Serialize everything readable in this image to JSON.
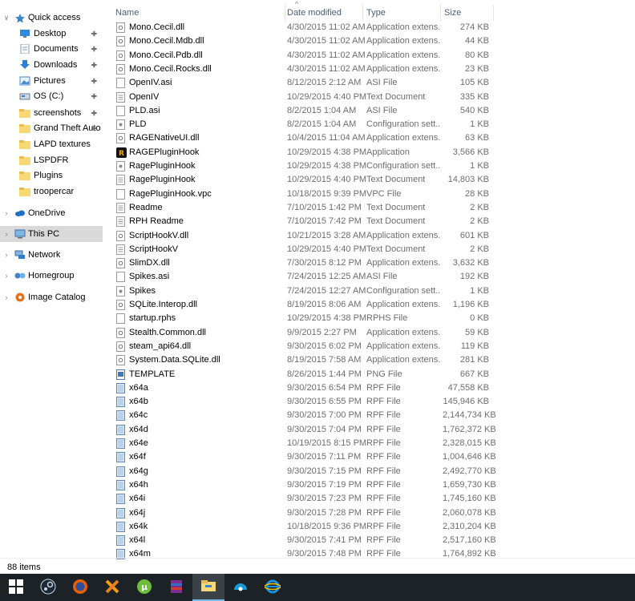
{
  "window": {
    "status_items": "88 items"
  },
  "colors": {
    "selected_bg": "#d9d9d9",
    "header_text": "#4c607a",
    "taskbar_bg": "#1c2226",
    "folder": "#f8d775"
  },
  "nav": {
    "items": [
      {
        "label": "Quick access",
        "icon": "star-icon",
        "chevron": "v",
        "pinned": false,
        "type": "root",
        "selected": false
      },
      {
        "label": "Desktop",
        "icon": "desktop-icon",
        "chevron": "",
        "pinned": true,
        "type": "child",
        "selected": false
      },
      {
        "label": "Documents",
        "icon": "documents-icon",
        "chevron": "",
        "pinned": true,
        "type": "child",
        "selected": false
      },
      {
        "label": "Downloads",
        "icon": "downloads-icon",
        "chevron": "",
        "pinned": true,
        "type": "child",
        "selected": false
      },
      {
        "label": "Pictures",
        "icon": "pictures-icon",
        "chevron": "",
        "pinned": true,
        "type": "child",
        "selected": false
      },
      {
        "label": "OS (C:)",
        "icon": "drive-icon",
        "chevron": "",
        "pinned": true,
        "type": "child",
        "selected": false
      },
      {
        "label": "screenshots",
        "icon": "folder-icon",
        "chevron": "",
        "pinned": true,
        "type": "child",
        "selected": false
      },
      {
        "label": "Grand Theft Auto",
        "icon": "folder-icon",
        "chevron": "",
        "pinned": true,
        "type": "child",
        "selected": false
      },
      {
        "label": "LAPD textures",
        "icon": "folder-icon",
        "chevron": "",
        "pinned": false,
        "type": "child",
        "selected": false
      },
      {
        "label": "LSPDFR",
        "icon": "folder-icon",
        "chevron": "",
        "pinned": false,
        "type": "child",
        "selected": false
      },
      {
        "label": "Plugins",
        "icon": "folder-icon",
        "chevron": "",
        "pinned": false,
        "type": "child",
        "selected": false
      },
      {
        "label": "troopercar",
        "icon": "folder-icon",
        "chevron": "",
        "pinned": false,
        "type": "child",
        "selected": false
      },
      {
        "label": "OneDrive",
        "icon": "cloud-icon",
        "chevron": ">",
        "pinned": false,
        "type": "root",
        "selected": false
      },
      {
        "label": "This PC",
        "icon": "computer-icon",
        "chevron": ">",
        "pinned": false,
        "type": "root",
        "selected": true
      },
      {
        "label": "Network",
        "icon": "network-icon",
        "chevron": ">",
        "pinned": false,
        "type": "root",
        "selected": false
      },
      {
        "label": "Homegroup",
        "icon": "homegroup-icon",
        "chevron": ">",
        "pinned": false,
        "type": "root",
        "selected": false
      },
      {
        "label": "Image Catalog",
        "icon": "catalog-icon",
        "chevron": ">",
        "pinned": false,
        "type": "root",
        "selected": false
      }
    ]
  },
  "columns": {
    "name": "Name",
    "date": "Date modified",
    "type": "Type",
    "size": "Size"
  },
  "files": [
    {
      "name": "Mono.Cecil.dll",
      "date": "4/30/2015 11:02 AM",
      "type": "Application extens...",
      "size": "274 KB",
      "icon": "dll-icon"
    },
    {
      "name": "Mono.Cecil.Mdb.dll",
      "date": "4/30/2015 11:02 AM",
      "type": "Application extens...",
      "size": "44 KB",
      "icon": "dll-icon"
    },
    {
      "name": "Mono.Cecil.Pdb.dll",
      "date": "4/30/2015 11:02 AM",
      "type": "Application extens...",
      "size": "80 KB",
      "icon": "dll-icon"
    },
    {
      "name": "Mono.Cecil.Rocks.dll",
      "date": "4/30/2015 11:02 AM",
      "type": "Application extens...",
      "size": "23 KB",
      "icon": "dll-icon"
    },
    {
      "name": "OpenIV.asi",
      "date": "8/12/2015 2:12 AM",
      "type": "ASI File",
      "size": "105 KB",
      "icon": "file-icon"
    },
    {
      "name": "OpenIV",
      "date": "10/29/2015 4:40 PM",
      "type": "Text Document",
      "size": "335 KB",
      "icon": "text-icon"
    },
    {
      "name": "PLD.asi",
      "date": "8/2/2015 1:04 AM",
      "type": "ASI File",
      "size": "540 KB",
      "icon": "file-icon"
    },
    {
      "name": "PLD",
      "date": "8/2/2015 1:04 AM",
      "type": "Configuration sett...",
      "size": "1 KB",
      "icon": "config-icon"
    },
    {
      "name": "RAGENativeUI.dll",
      "date": "10/4/2015 11:04 AM",
      "type": "Application extens...",
      "size": "63 KB",
      "icon": "dll-icon"
    },
    {
      "name": "RAGEPluginHook",
      "date": "10/29/2015 4:38 PM",
      "type": "Application",
      "size": "3,566 KB",
      "icon": "rage-app-icon"
    },
    {
      "name": "RagePluginHook",
      "date": "10/29/2015 4:38 PM",
      "type": "Configuration sett...",
      "size": "1 KB",
      "icon": "config-icon"
    },
    {
      "name": "RagePluginHook",
      "date": "10/29/2015 4:40 PM",
      "type": "Text Document",
      "size": "14,803 KB",
      "icon": "text-icon"
    },
    {
      "name": "RagePluginHook.vpc",
      "date": "10/18/2015 9:39 PM",
      "type": "VPC File",
      "size": "28 KB",
      "icon": "file-icon"
    },
    {
      "name": "Readme",
      "date": "7/10/2015 1:42 PM",
      "type": "Text Document",
      "size": "2 KB",
      "icon": "text-icon"
    },
    {
      "name": "RPH Readme",
      "date": "7/10/2015 7:42 PM",
      "type": "Text Document",
      "size": "2 KB",
      "icon": "text-icon"
    },
    {
      "name": "ScriptHookV.dll",
      "date": "10/21/2015 3:28 AM",
      "type": "Application extens...",
      "size": "601 KB",
      "icon": "dll-icon"
    },
    {
      "name": "ScriptHookV",
      "date": "10/29/2015 4:40 PM",
      "type": "Text Document",
      "size": "2 KB",
      "icon": "text-icon"
    },
    {
      "name": "SlimDX.dll",
      "date": "7/30/2015 8:12 PM",
      "type": "Application extens...",
      "size": "3,632 KB",
      "icon": "dll-icon"
    },
    {
      "name": "Spikes.asi",
      "date": "7/24/2015 12:25 AM",
      "type": "ASI File",
      "size": "192 KB",
      "icon": "file-icon"
    },
    {
      "name": "Spikes",
      "date": "7/24/2015 12:27 AM",
      "type": "Configuration sett...",
      "size": "1 KB",
      "icon": "config-icon"
    },
    {
      "name": "SQLite.Interop.dll",
      "date": "8/19/2015 8:06 AM",
      "type": "Application extens...",
      "size": "1,196 KB",
      "icon": "dll-icon"
    },
    {
      "name": "startup.rphs",
      "date": "10/29/2015 4:38 PM",
      "type": "RPHS File",
      "size": "0 KB",
      "icon": "file-icon"
    },
    {
      "name": "Stealth.Common.dll",
      "date": "9/9/2015 2:27 PM",
      "type": "Application extens...",
      "size": "59 KB",
      "icon": "dll-icon"
    },
    {
      "name": "steam_api64.dll",
      "date": "9/30/2015 6:02 PM",
      "type": "Application extens...",
      "size": "119 KB",
      "icon": "dll-icon"
    },
    {
      "name": "System.Data.SQLite.dll",
      "date": "8/19/2015 7:58 AM",
      "type": "Application extens...",
      "size": "281 KB",
      "icon": "dll-icon"
    },
    {
      "name": "TEMPLATE",
      "date": "8/26/2015 1:44 PM",
      "type": "PNG File",
      "size": "667 KB",
      "icon": "image-icon"
    },
    {
      "name": "x64a",
      "date": "9/30/2015 6:54 PM",
      "type": "RPF File",
      "size": "47,558 KB",
      "icon": "rpf-icon"
    },
    {
      "name": "x64b",
      "date": "9/30/2015 6:55 PM",
      "type": "RPF File",
      "size": "145,946 KB",
      "icon": "rpf-icon"
    },
    {
      "name": "x64c",
      "date": "9/30/2015 7:00 PM",
      "type": "RPF File",
      "size": "2,144,734 KB",
      "icon": "rpf-icon"
    },
    {
      "name": "x64d",
      "date": "9/30/2015 7:04 PM",
      "type": "RPF File",
      "size": "1,762,372 KB",
      "icon": "rpf-icon"
    },
    {
      "name": "x64e",
      "date": "10/19/2015 8:15 PM",
      "type": "RPF File",
      "size": "2,328,015 KB",
      "icon": "rpf-icon"
    },
    {
      "name": "x64f",
      "date": "9/30/2015 7:11 PM",
      "type": "RPF File",
      "size": "1,004,646 KB",
      "icon": "rpf-icon"
    },
    {
      "name": "x64g",
      "date": "9/30/2015 7:15 PM",
      "type": "RPF File",
      "size": "2,492,770 KB",
      "icon": "rpf-icon"
    },
    {
      "name": "x64h",
      "date": "9/30/2015 7:19 PM",
      "type": "RPF File",
      "size": "1,659,730 KB",
      "icon": "rpf-icon"
    },
    {
      "name": "x64i",
      "date": "9/30/2015 7:23 PM",
      "type": "RPF File",
      "size": "1,745,160 KB",
      "icon": "rpf-icon"
    },
    {
      "name": "x64j",
      "date": "9/30/2015 7:28 PM",
      "type": "RPF File",
      "size": "2,060,078 KB",
      "icon": "rpf-icon"
    },
    {
      "name": "x64k",
      "date": "10/18/2015 9:36 PM",
      "type": "RPF File",
      "size": "2,310,204 KB",
      "icon": "rpf-icon"
    },
    {
      "name": "x64l",
      "date": "9/30/2015 7:41 PM",
      "type": "RPF File",
      "size": "2,517,160 KB",
      "icon": "rpf-icon"
    },
    {
      "name": "x64m",
      "date": "9/30/2015 7:48 PM",
      "type": "RPF File",
      "size": "1,764,892 KB",
      "icon": "rpf-icon"
    }
  ],
  "taskbar": {
    "items": [
      {
        "icon": "windows-start-icon",
        "active": false
      },
      {
        "icon": "steam-icon",
        "active": false
      },
      {
        "icon": "firefox-icon",
        "active": false
      },
      {
        "icon": "x-app-icon",
        "active": false
      },
      {
        "icon": "utorrent-icon",
        "active": false
      },
      {
        "icon": "winrar-icon",
        "active": false
      },
      {
        "icon": "file-explorer-icon",
        "active": true
      },
      {
        "icon": "openiv-icon",
        "active": false
      },
      {
        "icon": "internet-explorer-icon",
        "active": false
      }
    ]
  }
}
